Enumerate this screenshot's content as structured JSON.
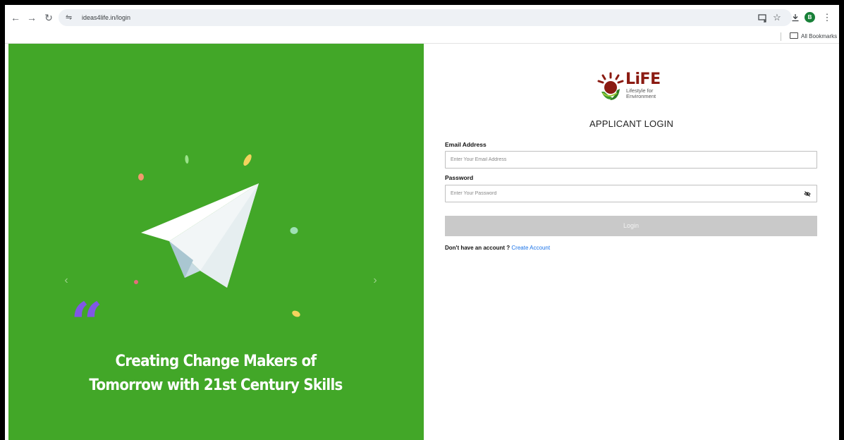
{
  "browser": {
    "url": "ideas4life.in/login",
    "profile_initial": "B",
    "bookmarks_label": "All Bookmarks"
  },
  "hero": {
    "quote_mark": "“",
    "tagline_line1": "Creating Change Makers of",
    "tagline_line2": "Tomorrow with 21st Century Skills",
    "prev_arrow": "‹",
    "next_arrow": "›",
    "background_color": "#42a728"
  },
  "login": {
    "logo_word": "LiFE",
    "logo_sub_line1": "Lifestyle for",
    "logo_sub_line2": "Environment",
    "title": "APPLICANT LOGIN",
    "email_label": "Email Address",
    "email_placeholder": "Enter Your Email Address",
    "email_value": "",
    "password_label": "Password",
    "password_placeholder": "Enter Your Password",
    "password_value": "",
    "login_button": "Login",
    "signup_prompt": "Don't have an account ?",
    "create_account": "Create Account",
    "link_color": "#1a73e8"
  },
  "icons": {
    "back": "back-arrow-icon",
    "forward": "forward-arrow-icon",
    "reload": "reload-icon",
    "site_settings": "tune-icon",
    "install": "install-app-icon",
    "bookmark": "star-icon",
    "download": "download-icon",
    "menu": "kebab-menu-icon",
    "folder": "folder-icon",
    "password_toggle": "eye-slash-icon"
  }
}
